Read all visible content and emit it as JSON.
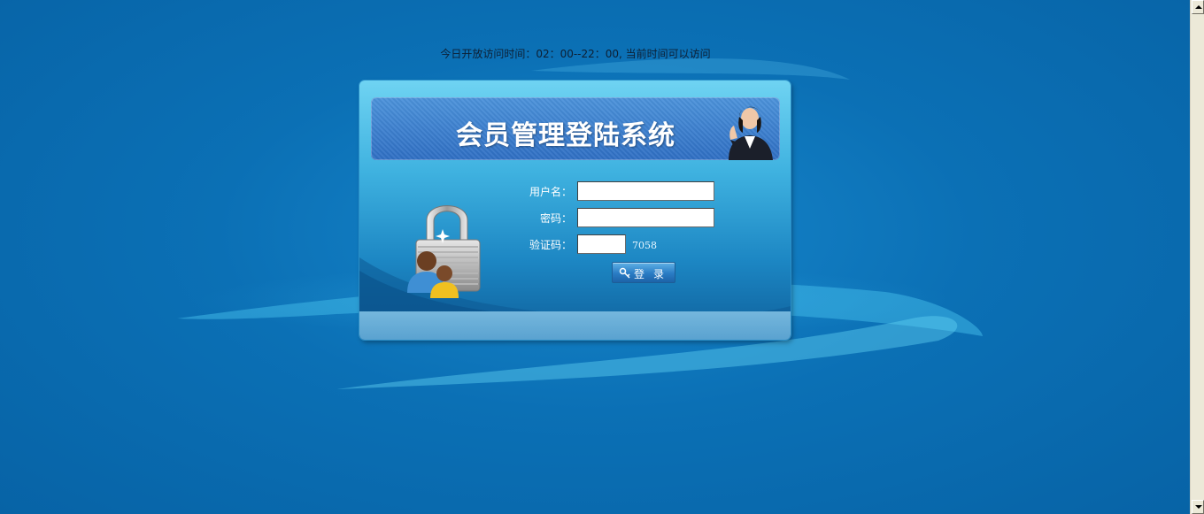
{
  "notice": {
    "text": "今日开放访问时间：02：00--22：00, 当前时间可以访问"
  },
  "banner": {
    "title": "会员管理登陆系统"
  },
  "form": {
    "username_label": "用户名：",
    "username_value": "",
    "password_label": "密码：",
    "password_value": "",
    "captcha_label": "验证码：",
    "captcha_value": "",
    "captcha_code": "7058",
    "login_label": "登录"
  },
  "colors": {
    "background": "#0a6db0",
    "panel_top": "#6fd3f2",
    "banner": "#3a7fd0",
    "button": "#2a7cc4"
  },
  "icons": [
    "lock-users-icon",
    "customer-service-person-icon",
    "key-icon"
  ]
}
